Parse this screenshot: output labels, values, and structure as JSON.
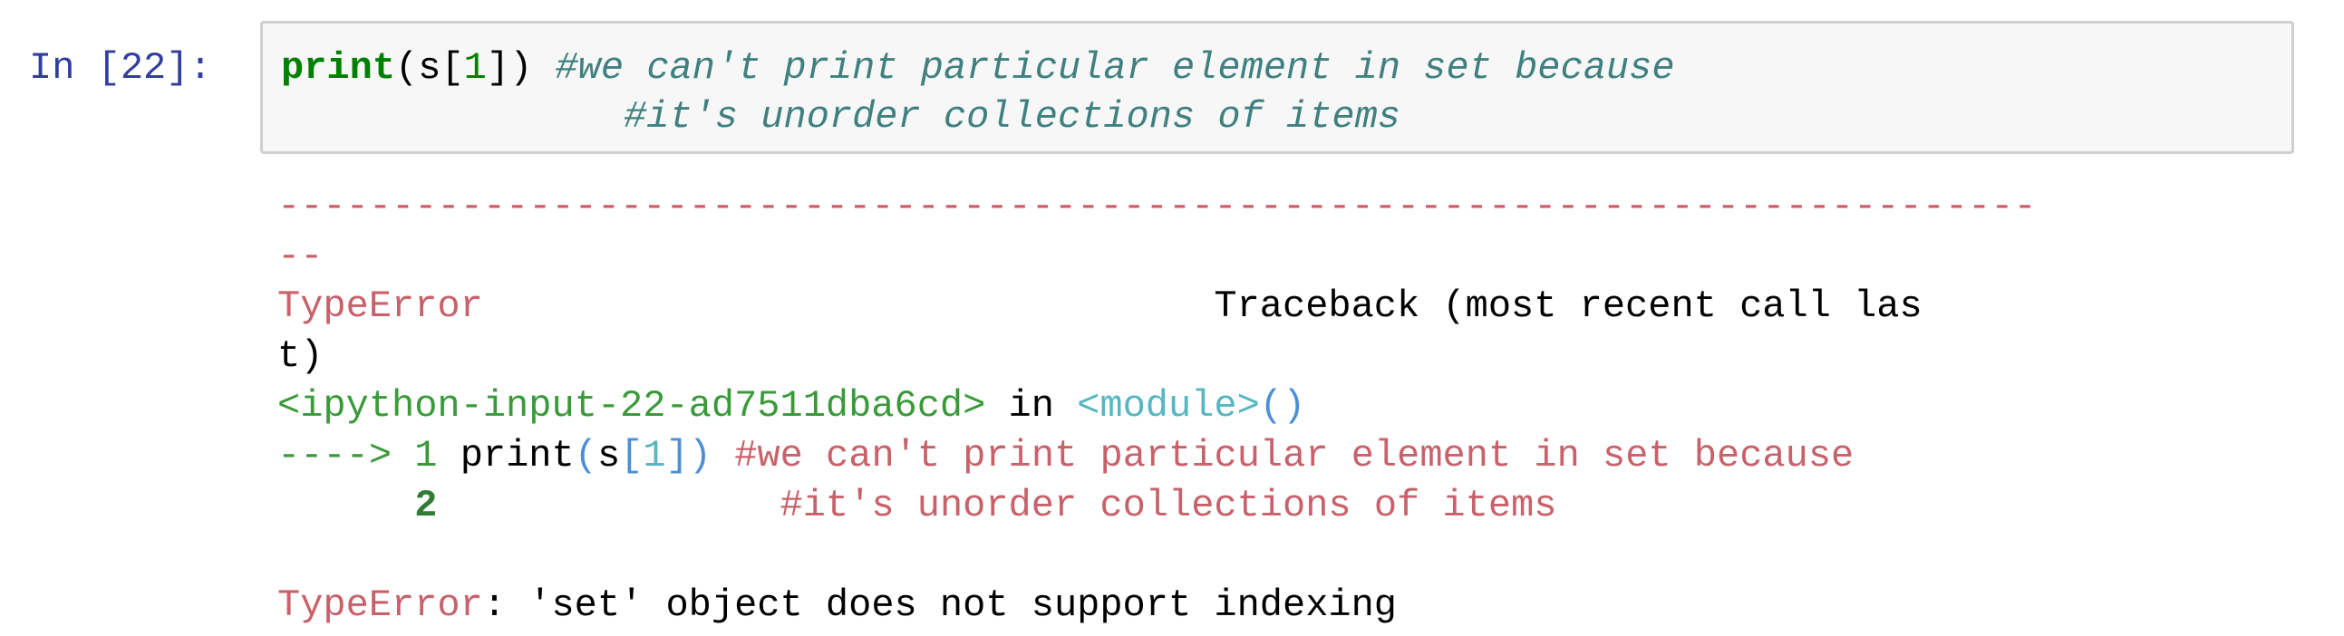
{
  "cell": {
    "prompt": "In [22]:",
    "code_line1": {
      "func": "print",
      "open": "(s[",
      "index": "1",
      "close": "])",
      "pad": " ",
      "comment": "#we can't print particular element in set because"
    },
    "code_line2": {
      "indent": "               ",
      "comment": "#it's unorder collections of items"
    }
  },
  "output": {
    "dash_line1": "-----------------------------------------------------------------------------",
    "dash_line2": "--",
    "error_type": "TypeError",
    "traceback_pad": "                                ",
    "traceback_label": "Traceback (most recent call las",
    "traceback_wrap": "t)",
    "input_ref": "<ipython-input-22-ad7511dba6cd>",
    "in_word": " in ",
    "module_ref": "<module>",
    "module_parens": "()",
    "arrow": "---->",
    "line1_num": "1",
    "line1_print": "print",
    "line1_open": "(",
    "line1_s": "s",
    "line1_bracket_open": "[",
    "line1_index": "1",
    "line1_bracket_close": "])",
    "line1_comment": "#we can't print particular element in set because",
    "line2_num": "2",
    "line2_comment": "#it's unorder collections of items",
    "final_error_type": "TypeError",
    "final_error_message": ": 'set' object does not support indexing"
  }
}
